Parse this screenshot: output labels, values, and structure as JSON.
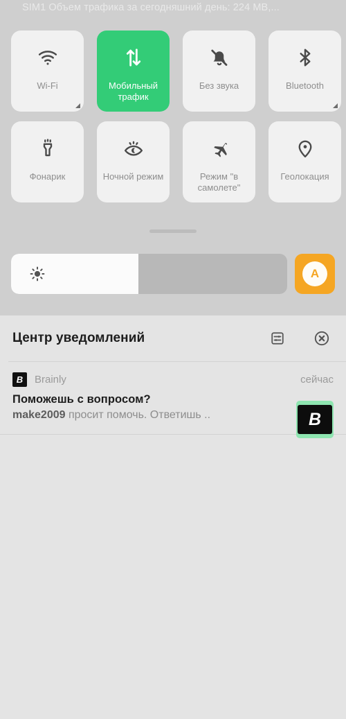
{
  "status_bar": {
    "text": "SIM1 Объем трафика за сегодняшний день: 224 MB,..."
  },
  "quick_settings": {
    "tiles": [
      {
        "id": "wifi",
        "label": "Wi-Fi",
        "icon": "wifi-icon",
        "active": false,
        "has_corner": true
      },
      {
        "id": "mobile-data",
        "label": "Мобильный трафик",
        "icon": "data-arrows-icon",
        "active": true,
        "has_corner": false
      },
      {
        "id": "silent",
        "label": "Без звука",
        "icon": "bell-off-icon",
        "active": false,
        "has_corner": false
      },
      {
        "id": "bluetooth",
        "label": "Bluetooth",
        "icon": "bluetooth-icon",
        "active": false,
        "has_corner": true
      },
      {
        "id": "flashlight",
        "label": "Фонарик",
        "icon": "flashlight-icon",
        "active": false,
        "has_corner": false
      },
      {
        "id": "night-mode",
        "label": "Ночной режим",
        "icon": "eye-moon-icon",
        "active": false,
        "has_corner": false
      },
      {
        "id": "airplane",
        "label": "Режим \"в самолете\"",
        "icon": "airplane-icon",
        "active": false,
        "has_corner": false
      },
      {
        "id": "location",
        "label": "Геолокация",
        "icon": "location-pin-icon",
        "active": false,
        "has_corner": false
      }
    ],
    "brightness": {
      "icon": "brightness-sun-icon",
      "value_percent": 46,
      "auto_label": "A"
    },
    "colors": {
      "tile_inactive": "#f1f1f1",
      "tile_active": "#33cc77",
      "shade_background": "#cfcfcf",
      "auto_brightness": "#f5a623"
    }
  },
  "notification_center": {
    "title": "Центр уведомлений",
    "settings_icon": "notification-settings-icon",
    "clear_icon": "clear-all-icon",
    "notifications": [
      {
        "app_name": "Brainly",
        "app_initial": "B",
        "time": "сейчас",
        "title": "Поможешь с вопросом?",
        "body_user": "make2009",
        "body_rest": " просит помочь. Ответишь ..",
        "logo_bg": "#8ee5b0"
      }
    ]
  }
}
